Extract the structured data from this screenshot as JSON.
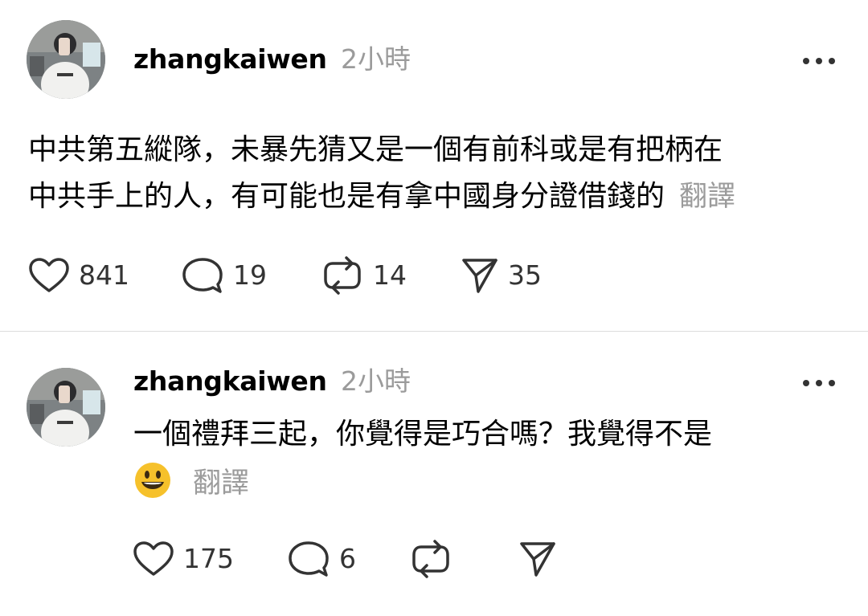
{
  "posts": [
    {
      "username": "zhangkaiwen",
      "timestamp": "2小時",
      "body_lines": [
        "中共第五縱隊，未暴先猜又是一個有前科或是有把柄在",
        "中共手上的人，有可能也是有拿中國身分證借錢的"
      ],
      "translate_label": "翻譯",
      "actions": {
        "likes": "841",
        "replies": "19",
        "reposts": "14",
        "shares": "35"
      }
    },
    {
      "username": "zhangkaiwen",
      "timestamp": "2小時",
      "body_lines": [
        "一個禮拜三起，你覺得是巧合嗎？我覺得不是"
      ],
      "emoji": "😃",
      "translate_label": "翻譯",
      "actions": {
        "likes": "175",
        "replies": "6",
        "reposts": "",
        "shares": ""
      }
    }
  ],
  "icons": {
    "more": "more-horizontal-icon",
    "like": "heart-icon",
    "reply": "comment-bubble-icon",
    "repost": "repost-icon",
    "share": "send-icon"
  },
  "colors": {
    "text": "#000000",
    "muted": "#9b9b9b",
    "icon": "#333333",
    "divider": "#dcdcdc",
    "emoji_face": "#f6c12b"
  }
}
